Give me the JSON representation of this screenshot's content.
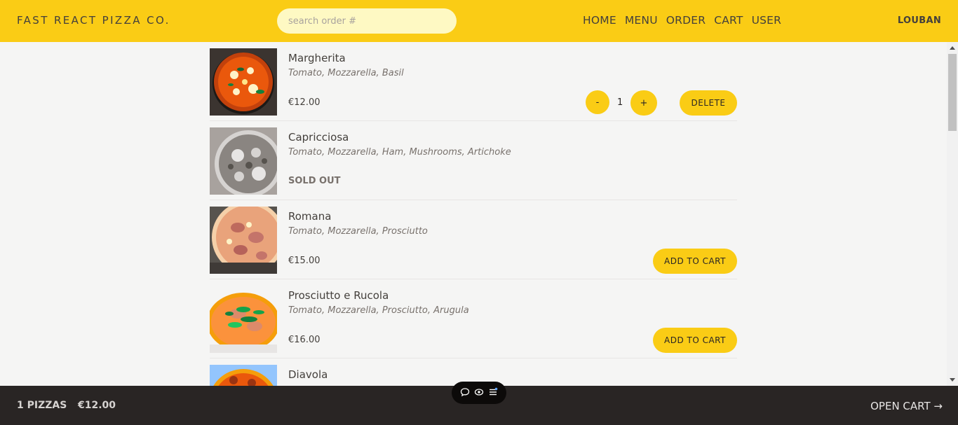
{
  "header": {
    "brand": "FAST REACT PIZZA CO.",
    "search_placeholder": "search order #",
    "nav": [
      "HOME",
      "MENU",
      "ORDER",
      "CART",
      "USER"
    ],
    "username": "LOUBAN"
  },
  "menu": [
    {
      "name": "Margherita",
      "ingredients": "Tomato, Mozzarella, Basil",
      "price": "€12.00",
      "in_cart": true,
      "quantity": "1",
      "decrease_label": "-",
      "increase_label": "+",
      "delete_label": "DELETE"
    },
    {
      "name": "Capricciosa",
      "ingredients": "Tomato, Mozzarella, Ham, Mushrooms, Artichoke",
      "status": "SOLD OUT",
      "sold_out": true
    },
    {
      "name": "Romana",
      "ingredients": "Tomato, Mozzarella, Prosciutto",
      "price": "€15.00",
      "add_label": "ADD TO CART"
    },
    {
      "name": "Prosciutto e Rucola",
      "ingredients": "Tomato, Mozzarella, Prosciutto, Arugula",
      "price": "€16.00",
      "add_label": "ADD TO CART"
    },
    {
      "name": "Diavola"
    }
  ],
  "footer": {
    "pizza_count": "1 PIZZAS",
    "total": "€12.00",
    "open_cart": "OPEN CART →"
  },
  "colors": {
    "accent": "#facc15",
    "background": "#f5f5f4",
    "footer": "#292524"
  },
  "icons": [
    "chat-bubble-icon",
    "eye-icon",
    "menu-lines-icon"
  ]
}
